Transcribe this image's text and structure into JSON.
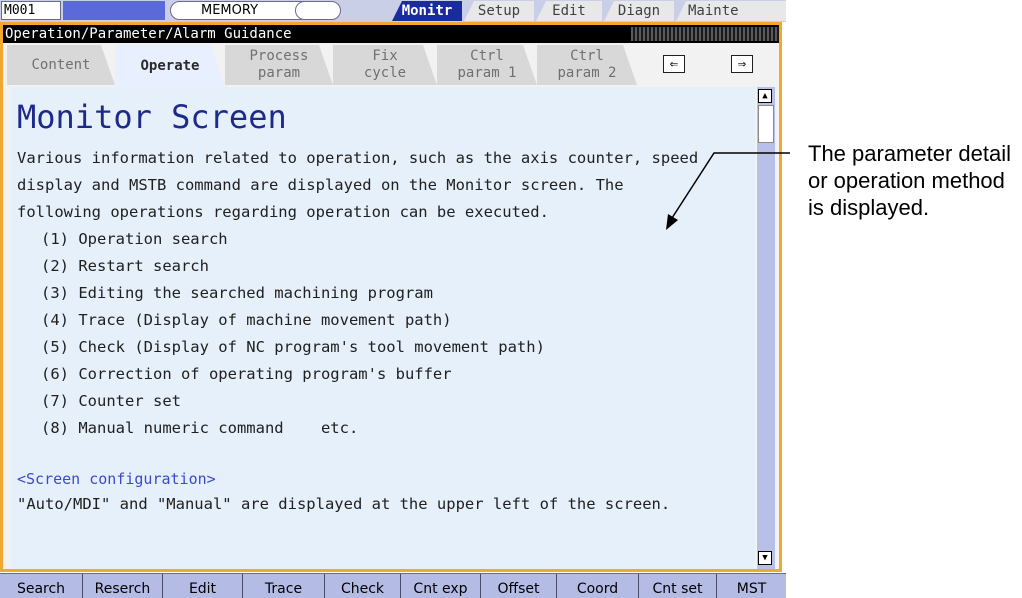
{
  "status_bar": {
    "system_id": "M001",
    "mode": "MEMORY",
    "tabs": [
      {
        "label": "Monitr",
        "active": true
      },
      {
        "label": "Setup",
        "active": false
      },
      {
        "label": "Edit",
        "active": false
      },
      {
        "label": "Diagn",
        "active": false
      },
      {
        "label": "Mainte",
        "active": false
      }
    ]
  },
  "guidance": {
    "title": "Operation/Parameter/Alarm Guidance",
    "tabs": [
      {
        "line1": "Content",
        "line2": "",
        "active": false
      },
      {
        "line1": "Operate",
        "line2": "",
        "active": true
      },
      {
        "line1": "Process",
        "line2": "param",
        "active": false
      },
      {
        "line1": "Fix",
        "line2": "cycle",
        "active": false
      },
      {
        "line1": "Ctrl",
        "line2": "param 1",
        "active": false
      },
      {
        "line1": "Ctrl",
        "line2": "param 2",
        "active": false
      }
    ],
    "back_arrow": "⇐",
    "forward_arrow": "⇒",
    "heading": "Monitor Screen",
    "paragraph_lines": [
      "Various information related to operation, such as the axis counter, speed",
      "display and MSTB command are displayed on the Monitor screen. The",
      "following operations regarding operation can be executed."
    ],
    "list": [
      "(1) Operation search",
      "(2) Restart search",
      "(3) Editing the searched machining program",
      "(4) Trace (Display of machine movement path)",
      "(5) Check (Display of NC program's tool movement path)",
      "(6) Correction of operating program's buffer",
      "(7) Counter set",
      "(8) Manual numeric command    etc."
    ],
    "section_heading": "<Screen configuration>",
    "section_text": "\"Auto/MDI\" and \"Manual\" are displayed at the upper left of the screen.",
    "scroll_up_icon": "▲",
    "scroll_down_icon": "▼"
  },
  "function_keys": [
    "Search",
    "Reserch",
    "Edit",
    "Trace",
    "Check",
    "Cnt exp",
    "Offset",
    "Coord",
    "Cnt set",
    "MST"
  ],
  "annotation": {
    "text": "The parameter detail or operation method is displayed."
  },
  "colors": {
    "frame_border": "#f0a830",
    "active_tab": "#1a2b9e",
    "heading": "#1e2a8a",
    "content_bg": "#e6f0fb"
  }
}
